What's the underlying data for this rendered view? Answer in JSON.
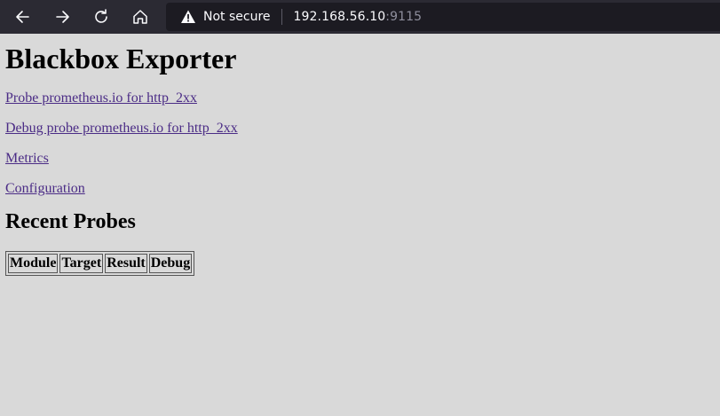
{
  "browser": {
    "security_label": "Not secure",
    "url_host": "192.168.56.10",
    "url_port": ":9115",
    "icons": [
      "back-arrow-icon",
      "forward-arrow-icon",
      "reload-icon",
      "home-icon",
      "warning-icon"
    ]
  },
  "page": {
    "title": "Blackbox Exporter",
    "links": [
      "Probe prometheus.io for http_2xx",
      "Debug probe prometheus.io for http_2xx",
      "Metrics",
      "Configuration"
    ],
    "recent_heading": "Recent Probes",
    "table_headers": [
      "Module",
      "Target",
      "Result",
      "Debug"
    ]
  },
  "colors": {
    "page_background": "#d9d9d9",
    "toolbar_background": "#2b2a33",
    "urlbar_background": "#1c1b22",
    "link_color": "#4b2c86"
  }
}
